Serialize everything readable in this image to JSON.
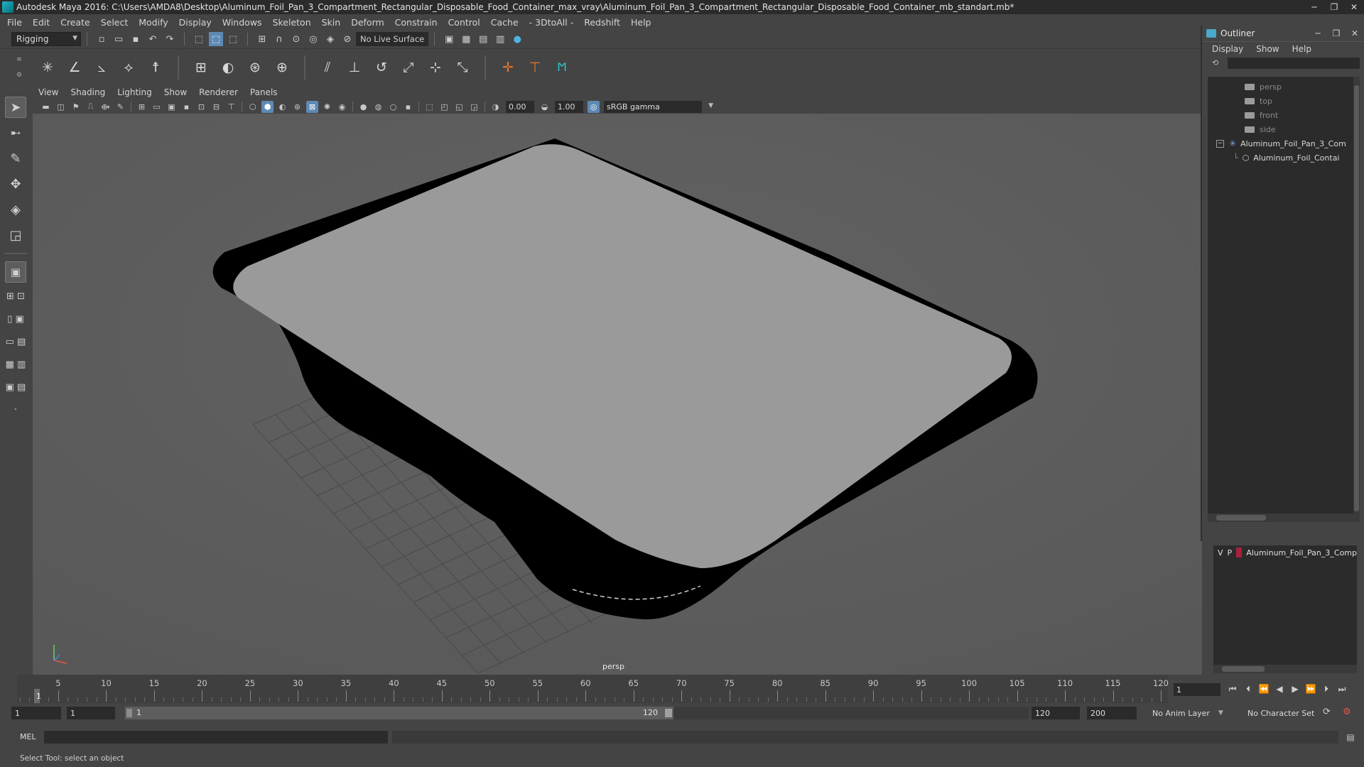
{
  "window": {
    "title": "Autodesk Maya 2016: C:\\Users\\AMDA8\\Desktop\\Aluminum_Foil_Pan_3_Compartment_Rectangular_Disposable_Food_Container_max_vray\\Aluminum_Foil_Pan_3_Compartment_Rectangular_Disposable_Food_Container_mb_standart.mb*",
    "minimize": "─",
    "restore": "❐",
    "close": "✕"
  },
  "menubar": [
    "File",
    "Edit",
    "Create",
    "Select",
    "Modify",
    "Display",
    "Windows",
    "Skeleton",
    "Skin",
    "Deform",
    "Constrain",
    "Control",
    "Cache",
    "- 3DtoAll -",
    "Redshift",
    "Help"
  ],
  "statusline": {
    "menuset": "Rigging",
    "live_surface": "No Live Surface"
  },
  "panel": {
    "menus": [
      "View",
      "Shading",
      "Lighting",
      "Show",
      "Renderer",
      "Panels"
    ],
    "exposure": "0.00",
    "gamma": "1.00",
    "colorspace": "sRGB gamma",
    "camera_label": "persp"
  },
  "outliner": {
    "title": "Outliner",
    "menus": [
      "Display",
      "Show",
      "Help"
    ],
    "cameras": [
      "persp",
      "top",
      "front",
      "side"
    ],
    "root_node": "Aluminum_Foil_Pan_3_Com",
    "child_node": "Aluminum_Foil_Contai",
    "expander": "−"
  },
  "layers": {
    "v": "V",
    "p": "P",
    "layer_name": "Aluminum_Foil_Pan_3_Comp",
    "layer_color": "#a8213c"
  },
  "timeline": {
    "ticks": [
      5,
      10,
      15,
      20,
      25,
      30,
      35,
      40,
      45,
      50,
      55,
      60,
      65,
      70,
      75,
      80,
      85,
      90,
      95,
      100,
      105,
      110,
      115,
      120
    ],
    "start": 1,
    "end": 120,
    "current_frame": "1",
    "current_field": "1"
  },
  "range": {
    "anim_start": "1",
    "playback_start": "1",
    "slider_start": "1",
    "slider_end": "120",
    "playback_end": "120",
    "anim_end": "200",
    "anim_layer": "No Anim Layer",
    "character_set": "No Character Set"
  },
  "cmdline": {
    "label": "MEL"
  },
  "helpline": {
    "text": "Select Tool: select an object"
  }
}
